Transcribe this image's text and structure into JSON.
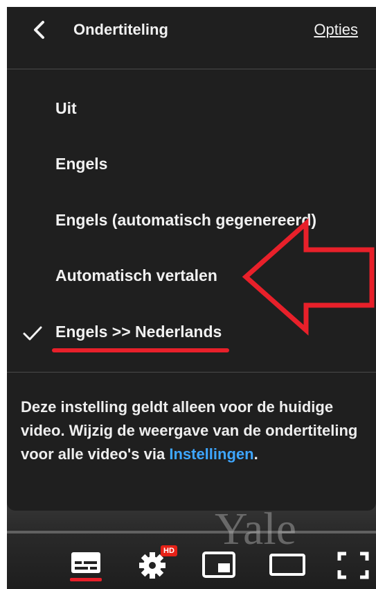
{
  "header": {
    "title": "Ondertiteling",
    "options_label": "Opties"
  },
  "menu": {
    "items": [
      {
        "label": "Uit",
        "selected": false
      },
      {
        "label": "Engels",
        "selected": false
      },
      {
        "label": "Engels (automatisch gegenereerd)",
        "selected": false
      },
      {
        "label": "Automatisch vertalen",
        "selected": false
      },
      {
        "label": "Engels >> Nederlands",
        "selected": true
      }
    ]
  },
  "info": {
    "text": "Deze instelling geldt alleen voor de huidige video. Wijzig de weergave van de ondertiteling voor alle video's via ",
    "link_label": "Instellingen",
    "suffix": "."
  },
  "video": {
    "watermark": "Yale"
  },
  "controls": {
    "hd_badge": "HD",
    "items": [
      "subtitles-icon",
      "gear-icon",
      "miniplayer-icon",
      "theater-mode-icon",
      "fullscreen-icon"
    ]
  },
  "colors": {
    "panel_bg": "#1f1f1f",
    "link": "#3ea6ff",
    "annotation": "#e8202a",
    "hd_badge": "#e62117"
  }
}
